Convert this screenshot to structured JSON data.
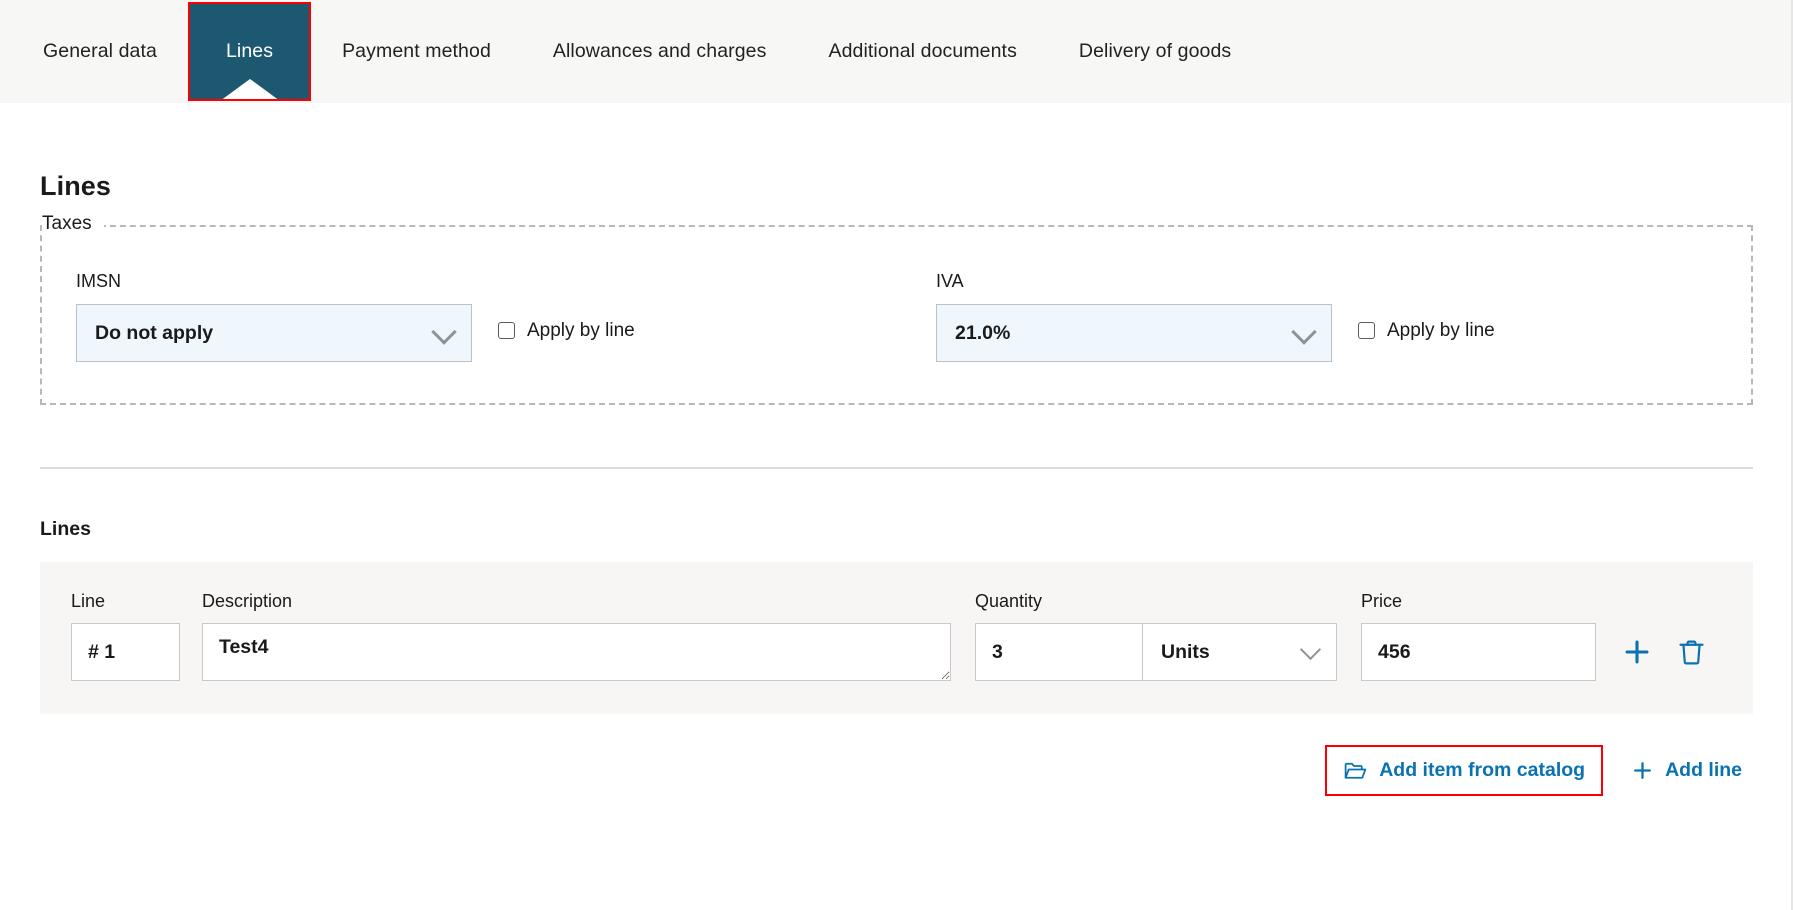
{
  "tabs": [
    {
      "label": "General data",
      "active": false
    },
    {
      "label": "Lines",
      "active": true
    },
    {
      "label": "Payment method",
      "active": false
    },
    {
      "label": "Allowances and charges",
      "active": false
    },
    {
      "label": "Additional documents",
      "active": false
    },
    {
      "label": "Delivery of goods",
      "active": false
    }
  ],
  "page": {
    "title": "Lines"
  },
  "taxes": {
    "legend": "Taxes",
    "imsn": {
      "label": "IMSN",
      "value": "Do not apply",
      "checkbox_label": "Apply by line",
      "checked": false
    },
    "iva": {
      "label": "IVA",
      "value": "21.0%",
      "checkbox_label": "Apply by line",
      "checked": false
    }
  },
  "lines_section": {
    "title": "Lines",
    "columns": {
      "line": "Line",
      "description": "Description",
      "quantity": "Quantity",
      "price": "Price"
    },
    "rows": [
      {
        "line": "# 1",
        "description": "Test4",
        "quantity": "3",
        "unit": "Units",
        "price": "456"
      }
    ]
  },
  "actions": {
    "add_from_catalog": "Add item from catalog",
    "add_line": "Add line"
  },
  "colors": {
    "active_tab_bg": "#1d5871",
    "highlight_border": "#ff0000",
    "link_blue": "#0b72b0",
    "select_bg": "#eff6fc",
    "panel_bg": "#f7f6f4",
    "tabbar_bg": "#f7f7f5"
  }
}
